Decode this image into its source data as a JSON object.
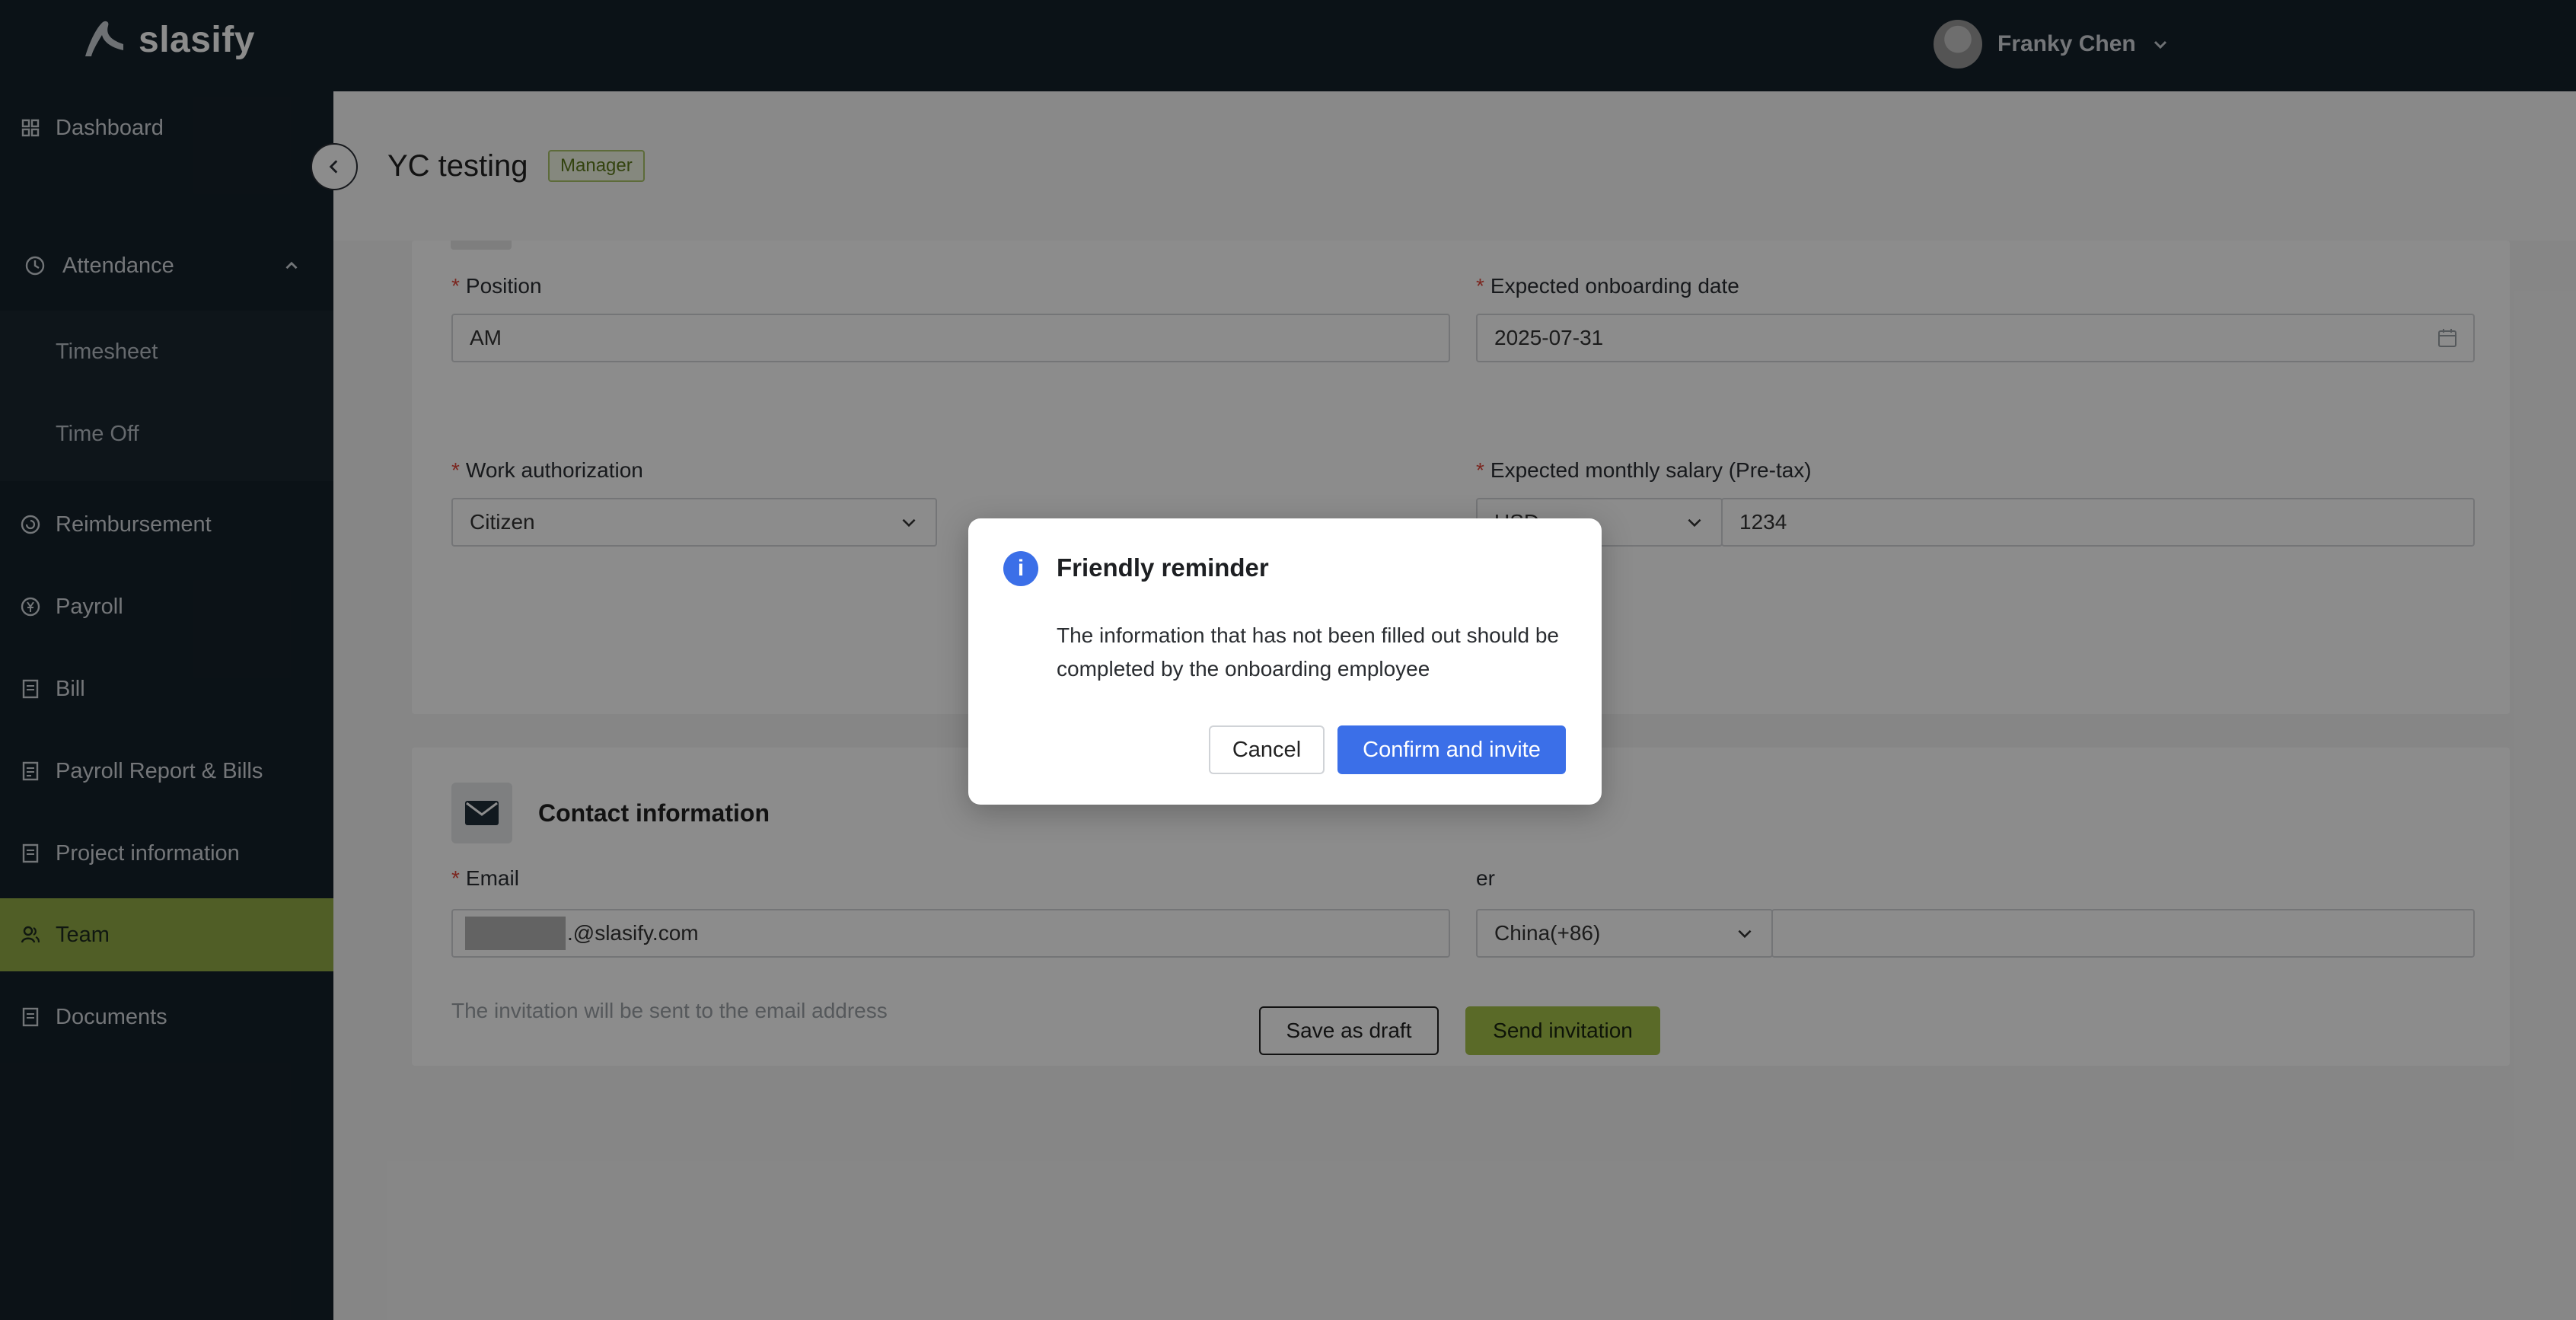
{
  "brand": {
    "name": "slasify"
  },
  "user": {
    "name": "Franky Chen"
  },
  "sidebar": {
    "items": [
      {
        "label": "Dashboard",
        "icon": "dashboard-icon"
      },
      {
        "label": "Attendance",
        "icon": "clock-icon"
      },
      {
        "label": "Timesheet"
      },
      {
        "label": "Time Off"
      },
      {
        "label": "Reimbursement",
        "icon": "reimbursement-icon"
      },
      {
        "label": "Payroll",
        "icon": "yen-coin-icon"
      },
      {
        "label": "Bill",
        "icon": "document-icon"
      },
      {
        "label": "Payroll Report & Bills",
        "icon": "report-icon"
      },
      {
        "label": "Project information",
        "icon": "document-icon"
      },
      {
        "label": "Team",
        "icon": "team-icon",
        "active": true
      },
      {
        "label": "Documents",
        "icon": "document-icon"
      }
    ]
  },
  "page": {
    "title": "YC testing",
    "role_badge": "Manager"
  },
  "form": {
    "position": {
      "label": "Position",
      "value": "AM"
    },
    "onboarding_date": {
      "label": "Expected onboarding date",
      "value": "2025-07-31"
    },
    "work_authorization": {
      "label": "Work authorization",
      "value": "Citizen"
    },
    "salary": {
      "label": "Expected monthly salary (Pre-tax)",
      "currency": "USD",
      "value": "1234"
    },
    "contact_section_title": "Contact information",
    "email": {
      "label": "Email",
      "value": ".@slasify.com"
    },
    "phone": {
      "label_partial": "er",
      "country_code": "China(+86)",
      "value": ""
    },
    "invitation_hint": "The invitation will be sent to the email address"
  },
  "actions": {
    "save_draft": "Save as draft",
    "send_invitation": "Send invitation"
  },
  "modal": {
    "title": "Friendly reminder",
    "icon_glyph": "i",
    "body": "The information that has not been filled out should be completed by the onboarding employee",
    "cancel": "Cancel",
    "confirm": "Confirm and invite"
  },
  "colors": {
    "sidebar_bg": "#15212a",
    "active_nav": "#92ac45",
    "primary": "#3b6fe8",
    "send_button": "#a4c14a"
  }
}
